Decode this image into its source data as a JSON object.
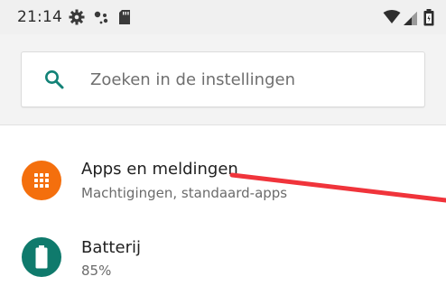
{
  "status_bar": {
    "time": "21:14",
    "left_icons": [
      "gear-icon",
      "assistant-dots-icon",
      "sd-card-icon"
    ],
    "right_icons": [
      "wifi-icon",
      "cell-signal-icon",
      "battery-icon"
    ]
  },
  "search": {
    "placeholder": "Zoeken in de instellingen",
    "icon": "search-icon",
    "accent": "#128277"
  },
  "settings": {
    "items": [
      {
        "title": "Apps en meldingen",
        "subtitle": "Machtigingen, standaard-apps",
        "icon": "apps-grid-icon",
        "icon_color": "#f46f0d"
      },
      {
        "title": "Batterij",
        "subtitle": "85%",
        "icon": "battery-icon",
        "icon_color": "#0f7a6c"
      }
    ]
  },
  "annotation": {
    "color": "#f0343b"
  }
}
